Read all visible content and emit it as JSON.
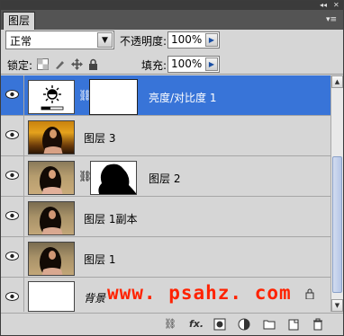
{
  "panel": {
    "tab_label": "图层",
    "collapse_glyph": "◂◂",
    "close_glyph": "✕",
    "menu_glyph": "▾≡"
  },
  "blend": {
    "mode": "正常",
    "opacity_label": "不透明度:",
    "opacity_value": "100%",
    "fill_label": "填充:",
    "fill_value": "100%",
    "lock_label": "锁定:"
  },
  "layers": [
    {
      "name": "亮度/对比度 1",
      "selected": true,
      "has_mask": true
    },
    {
      "name": "图层 3",
      "selected": false,
      "has_mask": false
    },
    {
      "name": "图层 2",
      "selected": false,
      "has_mask": true
    },
    {
      "name": "图层 1副本",
      "selected": false,
      "has_mask": false
    },
    {
      "name": "图层 1",
      "selected": false,
      "has_mask": false
    },
    {
      "name": "背景",
      "selected": false,
      "has_mask": false,
      "locked": true
    }
  ],
  "watermark": "www. psahz. com",
  "colors": {
    "selection": "#3874d8",
    "panel_bg": "#d6d6d6",
    "watermark": "#ff2200"
  },
  "icons": [
    "link-icon",
    "fx-icon",
    "mask-icon",
    "adjustment-icon",
    "group-folder-icon",
    "new-layer-icon",
    "trash-icon"
  ]
}
